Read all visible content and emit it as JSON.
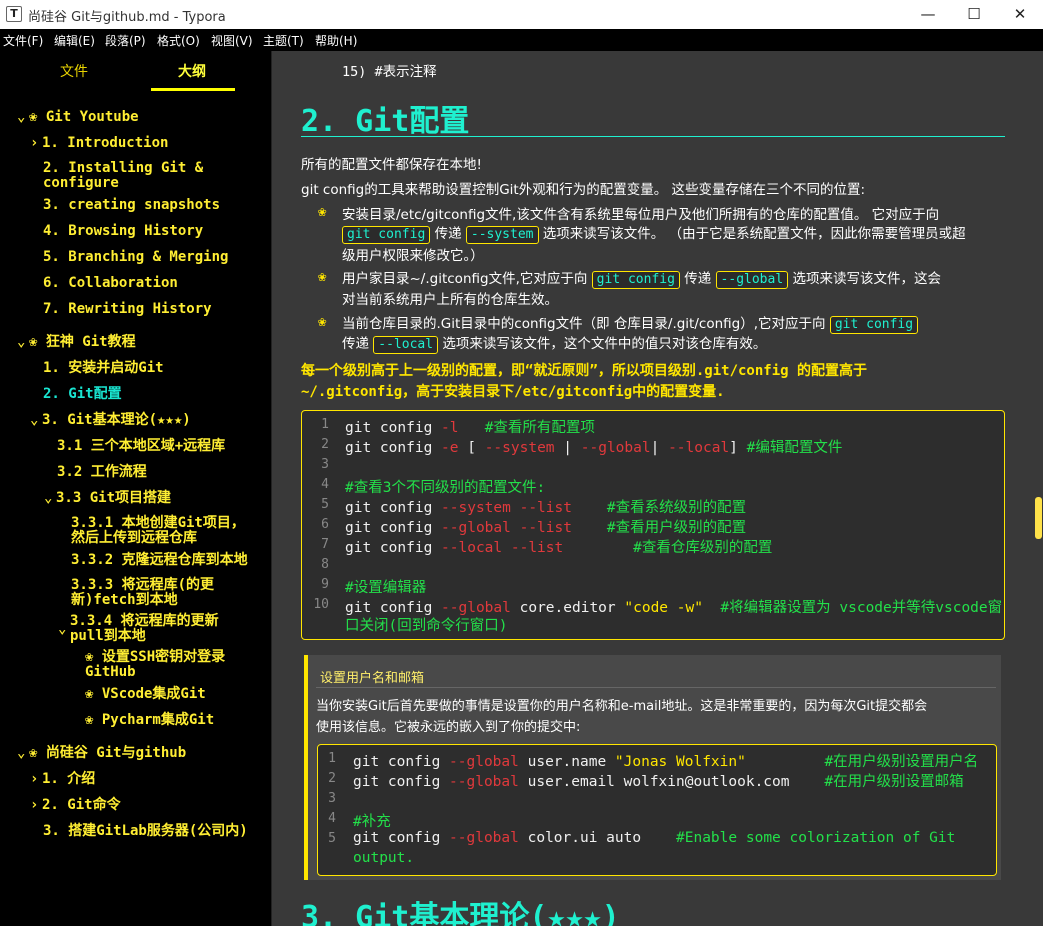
{
  "window": {
    "app_icon": "T",
    "title": "尚硅谷 Git与github.md - Typora",
    "minimize": "—",
    "maximize": "☐",
    "close": "✕"
  },
  "menu": [
    "文件(F)",
    "编辑(E)",
    "段落(P)",
    "格式(O)",
    "视图(V)",
    "主题(T)",
    "帮助(H)"
  ],
  "sidebar": {
    "tabs": {
      "files": "文件",
      "outline": "大纲"
    },
    "outline": [
      {
        "toggle": "⌄",
        "text": "❀ Git Youtube"
      },
      {
        "toggle": "›",
        "text": "1. Introduction"
      },
      {
        "toggle": "",
        "text": "2. Installing Git & configure"
      },
      {
        "toggle": "",
        "text": "3. creating snapshots"
      },
      {
        "toggle": "",
        "text": "4. Browsing History"
      },
      {
        "toggle": "",
        "text": "5. Branching & Merging"
      },
      {
        "toggle": "",
        "text": "6. Collaboration"
      },
      {
        "toggle": "",
        "text": "7. Rewriting History"
      },
      {
        "toggle": "⌄",
        "text": "❀ 狂神 Git教程"
      },
      {
        "toggle": "",
        "text": "1. 安装并启动Git"
      },
      {
        "toggle": "",
        "text": "2. Git配置"
      },
      {
        "toggle": "⌄",
        "text": "3. Git基本理论(★★★)"
      },
      {
        "toggle": "",
        "text": "3.1 三个本地区域+远程库"
      },
      {
        "toggle": "",
        "text": "3.2 工作流程"
      },
      {
        "toggle": "⌄",
        "text": "3.3 Git项目搭建"
      },
      {
        "toggle": "",
        "text": "3.3.1 本地创建Git项目，然后上传到远程仓库"
      },
      {
        "toggle": "",
        "text": "3.3.2 克隆远程仓库到本地"
      },
      {
        "toggle": "",
        "text": "3.3.3 将远程库(的更新)fetch到本地"
      },
      {
        "toggle": "⌄",
        "text": "3.3.4 将远程库的更新pull到本地"
      },
      {
        "toggle": "",
        "text": "❀ 设置SSH密钥对登录GitHub"
      },
      {
        "toggle": "",
        "text": "❀ VScode集成Git"
      },
      {
        "toggle": "",
        "text": "❀ Pycharm集成Git"
      },
      {
        "toggle": "⌄",
        "text": "❀ 尚硅谷 Git与github"
      },
      {
        "toggle": "›",
        "text": "1. 介绍"
      },
      {
        "toggle": "›",
        "text": "2. Git命令"
      },
      {
        "toggle": "",
        "text": "3. 搭建GitLab服务器(公司内)"
      }
    ]
  },
  "editor": {
    "prev_line": "15) #表示注释",
    "heading2": "2. Git配置",
    "p1": "所有的配置文件都保存在本地!",
    "p2": "git config的工具来帮助设置控制Git外观和行为的配置变量。 这些变量存储在三个不同的位置:",
    "bullet_icon": "❀",
    "li1": {
      "a": "安装目录/etc/gitconfig文件,该文件含有系统里每位用户及他们所拥有的仓库的配置值。 它对应于向",
      "code1": "git config",
      "b": "传递",
      "code2": "--system",
      "c": "选项来读写该文件。 （由于它是系统配置文件，因此你需要管理员或超",
      "d": "级用户权限来修改它。）"
    },
    "li2": {
      "a": "用户家目录~/.gitconfig文件,它对应于向",
      "code1": "git config",
      "b": "传递",
      "code2": "--global",
      "c": "选项来读写该文件，这会",
      "d": "对当前系统用户上所有的仓库生效。"
    },
    "li3": {
      "a": "当前仓库目录的.Git目录中的config文件（即 仓库目录/.git/config）,它对应于向",
      "code1": "git config",
      "b": "传递",
      "code2": "--local",
      "c": "选项来读写该文件，这个文件中的值只对该仓库有效。"
    },
    "strong1": "每一个级别高于上一级别的配置，即“就近原则”，所以项目级别.git/config 的配置高于",
    "strong2": "~/.gitconfig，高于安装目录下/etc/gitconfig中的配置变量.",
    "code1": [
      [
        {
          "c": "w",
          "t": "git config "
        },
        {
          "c": "r",
          "t": "-l"
        },
        {
          "c": "w",
          "t": "   "
        },
        {
          "c": "g",
          "t": "#查看所有配置项"
        }
      ],
      [
        {
          "c": "w",
          "t": "git config "
        },
        {
          "c": "r",
          "t": "-e"
        },
        {
          "c": "w",
          "t": " [ "
        },
        {
          "c": "r",
          "t": "--system"
        },
        {
          "c": "w",
          "t": " | "
        },
        {
          "c": "r",
          "t": "--global"
        },
        {
          "c": "w",
          "t": "| "
        },
        {
          "c": "r",
          "t": "--local"
        },
        {
          "c": "w",
          "t": "] "
        },
        {
          "c": "g",
          "t": "#编辑配置文件"
        }
      ],
      [],
      [
        {
          "c": "g",
          "t": "#查看3个不同级别的配置文件:"
        }
      ],
      [
        {
          "c": "w",
          "t": "git config "
        },
        {
          "c": "r",
          "t": "--system --list"
        },
        {
          "c": "w",
          "t": "    "
        },
        {
          "c": "g",
          "t": "#查看系统级别的配置"
        }
      ],
      [
        {
          "c": "w",
          "t": "git config "
        },
        {
          "c": "r",
          "t": "--global --list"
        },
        {
          "c": "w",
          "t": "    "
        },
        {
          "c": "g",
          "t": "#查看用户级别的配置"
        }
      ],
      [
        {
          "c": "w",
          "t": "git config "
        },
        {
          "c": "r",
          "t": "--local --list"
        },
        {
          "c": "w",
          "t": "        "
        },
        {
          "c": "g",
          "t": "#查看仓库级别的配置"
        }
      ],
      [],
      [
        {
          "c": "g",
          "t": "#设置编辑器"
        }
      ],
      [
        {
          "c": "w",
          "t": "git config "
        },
        {
          "c": "r",
          "t": "--global"
        },
        {
          "c": "w",
          "t": " core.editor "
        },
        {
          "c": "y",
          "t": "\"code -w\""
        },
        {
          "c": "w",
          "t": "  "
        },
        {
          "c": "g",
          "t": "#将编辑器设置为 vscode并等待vscode窗"
        }
      ]
    ],
    "code1_wrap": "口关闭(回到命令行窗口)",
    "callout_title": "设置用户名和邮箱",
    "callout_p1": "当你安装Git后首先要做的事情是设置你的用户名称和e-mail地址。这是非常重要的，因为每次Git提交都会",
    "callout_p2": "使用该信息。它被永远的嵌入到了你的提交中:",
    "code2": [
      [
        {
          "c": "w",
          "t": "git config "
        },
        {
          "c": "r",
          "t": "--global"
        },
        {
          "c": "w",
          "t": " user.name "
        },
        {
          "c": "y",
          "t": "\"Jonas Wolfxin\""
        },
        {
          "c": "w",
          "t": "         "
        },
        {
          "c": "g",
          "t": "#在用户级别设置用户名"
        }
      ],
      [
        {
          "c": "w",
          "t": "git config "
        },
        {
          "c": "r",
          "t": "--global"
        },
        {
          "c": "w",
          "t": " user.email wolfxin@outlook.com    "
        },
        {
          "c": "g",
          "t": "#在用户级别设置邮箱"
        }
      ],
      [],
      [
        {
          "c": "g",
          "t": "#补充"
        }
      ],
      [
        {
          "c": "w",
          "t": "git config "
        },
        {
          "c": "r",
          "t": "--global"
        },
        {
          "c": "w",
          "t": " color.ui auto    "
        },
        {
          "c": "g",
          "t": "#Enable some colorization of Git"
        }
      ]
    ],
    "code2_wrap": "output.",
    "heading3": "3. Git基本理论(★★★)"
  }
}
